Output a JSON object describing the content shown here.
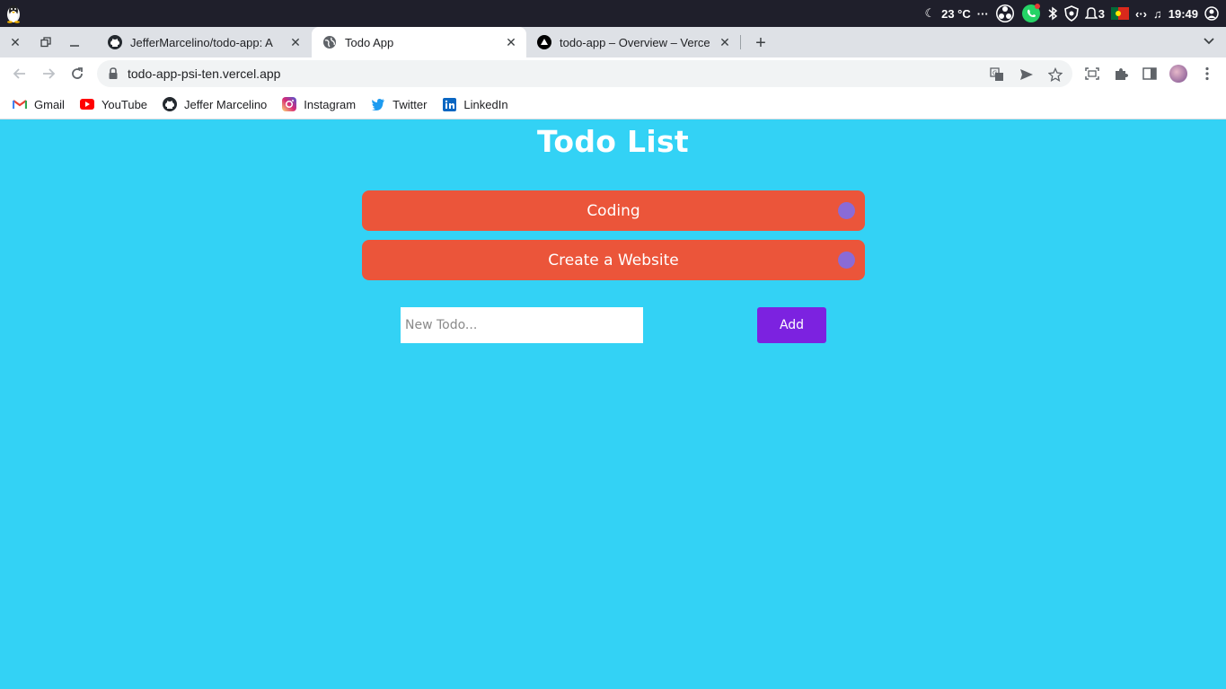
{
  "os": {
    "weather": "23 °C",
    "more": "···",
    "notifications_count": "3",
    "time": "19:49",
    "icons": [
      "tux-icon",
      "moon-icon",
      "obs-icon",
      "whatsapp-icon",
      "bluetooth-icon",
      "shield-icon",
      "bell-icon",
      "flag-icon",
      "arrows-icon",
      "music-icon",
      "user-icon"
    ]
  },
  "tabs": [
    {
      "title": "JefferMarcelino/todo-app: A",
      "favicon": "github-icon",
      "active": false
    },
    {
      "title": "Todo App",
      "favicon": "globe-icon",
      "active": true
    },
    {
      "title": "todo-app – Overview – Vercel",
      "favicon": "vercel-icon",
      "active": false
    }
  ],
  "address": {
    "url": "todo-app-psi-ten.vercel.app"
  },
  "bookmarks": [
    {
      "label": "Gmail",
      "icon": "gmail-icon"
    },
    {
      "label": "YouTube",
      "icon": "youtube-icon"
    },
    {
      "label": "Jeffer Marcelino",
      "icon": "github-icon"
    },
    {
      "label": "Instagram",
      "icon": "instagram-icon"
    },
    {
      "label": "Twitter",
      "icon": "twitter-icon"
    },
    {
      "label": "LinkedIn",
      "icon": "linkedin-icon"
    }
  ],
  "app": {
    "title": "Todo List",
    "todos": [
      {
        "text": "Coding"
      },
      {
        "text": "Create a Website"
      }
    ],
    "input_placeholder": "New Todo...",
    "add_label": "Add"
  },
  "colors": {
    "page_bg": "#33d2f5",
    "todo_bg": "#eb553a",
    "todo_dot": "#8a6bd6",
    "add_button": "#7c22e0"
  }
}
